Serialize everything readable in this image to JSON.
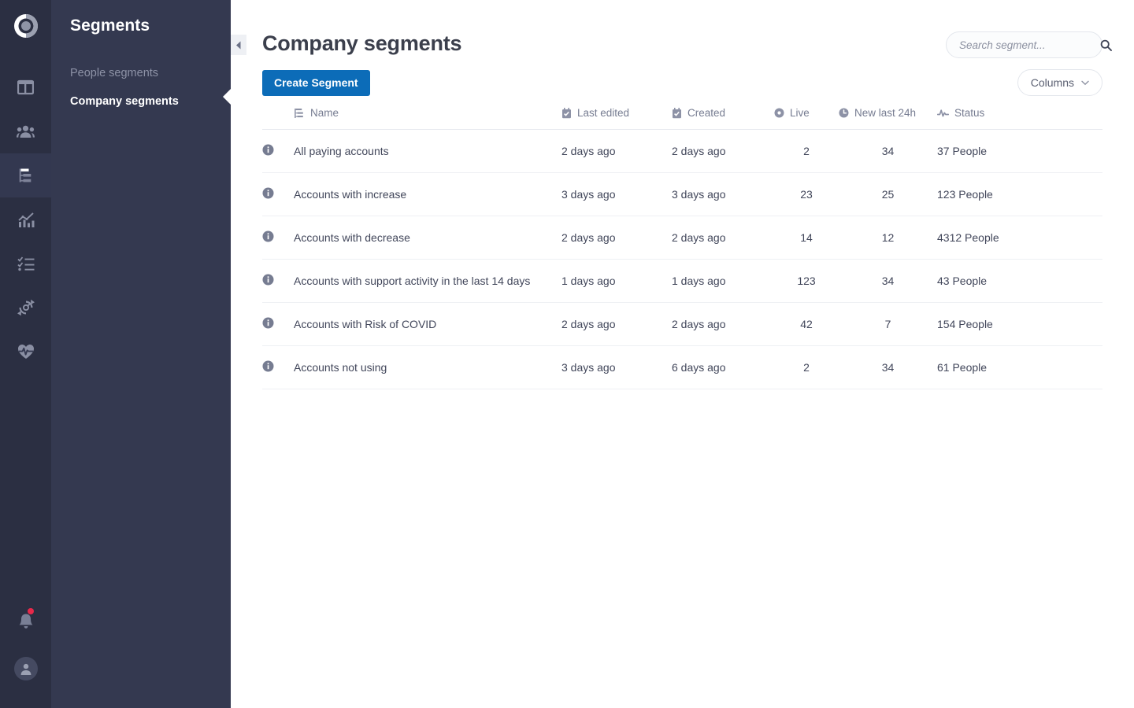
{
  "rail": {
    "logo_name": "app-logo",
    "items": [
      {
        "id": "dashboard",
        "icon": "dashboard-icon",
        "active": false
      },
      {
        "id": "people",
        "icon": "people-icon",
        "active": false
      },
      {
        "id": "segments",
        "icon": "segments-icon",
        "active": true
      },
      {
        "id": "analytics",
        "icon": "chart-icon",
        "active": false
      },
      {
        "id": "tasks",
        "icon": "checklist-icon",
        "active": false
      },
      {
        "id": "sync",
        "icon": "refresh-icon",
        "active": false
      },
      {
        "id": "health",
        "icon": "heartbeat-icon",
        "active": false
      }
    ],
    "bell_icon": "notification-bell-icon",
    "bell_has_alert": true,
    "avatar_icon": "user-avatar-icon"
  },
  "sidebar": {
    "title": "Segments",
    "items": [
      {
        "label": "People segments",
        "active": false
      },
      {
        "label": "Company segments",
        "active": true
      }
    ]
  },
  "collapse": {
    "icon": "chevron-left-icon"
  },
  "header": {
    "title": "Company segments"
  },
  "search": {
    "placeholder": "Search segment...",
    "value": "",
    "icon": "search-icon"
  },
  "toolbar": {
    "create_label": "Create Segment",
    "columns_label": "Columns",
    "columns_chevron": "chevron-down-icon"
  },
  "table": {
    "columns": [
      {
        "key": "name",
        "label": "Name",
        "icon": "sort-hierarchy-icon"
      },
      {
        "key": "last_edited",
        "label": "Last edited",
        "icon": "calendar-check-icon"
      },
      {
        "key": "created",
        "label": "Created",
        "icon": "calendar-check-icon"
      },
      {
        "key": "live",
        "label": "Live",
        "icon": "record-dot-icon"
      },
      {
        "key": "new_last_24h",
        "label": "New last 24h",
        "icon": "clock-icon"
      },
      {
        "key": "status",
        "label": "Status",
        "icon": "activity-pulse-icon"
      }
    ],
    "rows": [
      {
        "info_icon": "info-icon",
        "name": "All paying accounts",
        "last_edited": "2 days ago",
        "created": "2 days ago",
        "live": "2",
        "new_last_24h": "34",
        "status": "37 People"
      },
      {
        "info_icon": "info-icon",
        "name": "Accounts with increase",
        "last_edited": "3 days ago",
        "created": "3 days ago",
        "live": "23",
        "new_last_24h": "25",
        "status": "123 People"
      },
      {
        "info_icon": "info-icon",
        "name": "Accounts with decrease",
        "last_edited": "2 days ago",
        "created": "2 days ago",
        "live": "14",
        "new_last_24h": "12",
        "status": "4312 People"
      },
      {
        "info_icon": "info-icon",
        "name": "Accounts with support activity in the last 14 days",
        "last_edited": "1 days ago",
        "created": "1 days ago",
        "live": "123",
        "new_last_24h": "34",
        "status": "43 People"
      },
      {
        "info_icon": "info-icon",
        "name": "Accounts with Risk of COVID",
        "last_edited": "2 days ago",
        "created": "2 days ago",
        "live": "42",
        "new_last_24h": "7",
        "status": "154 People"
      },
      {
        "info_icon": "info-icon",
        "name": "Accounts not using",
        "last_edited": "3 days ago",
        "created": "6 days ago",
        "live": "2",
        "new_last_24h": "34",
        "status": "61 People"
      }
    ]
  },
  "colors": {
    "rail_bg": "#2b2f42",
    "rail_active_bg": "#333850",
    "sidebar_bg": "#343950",
    "primary_button": "#0c6cb8",
    "notification_dot": "#e8294a",
    "text_dark": "#41465a",
    "text_muted": "#767c91"
  }
}
